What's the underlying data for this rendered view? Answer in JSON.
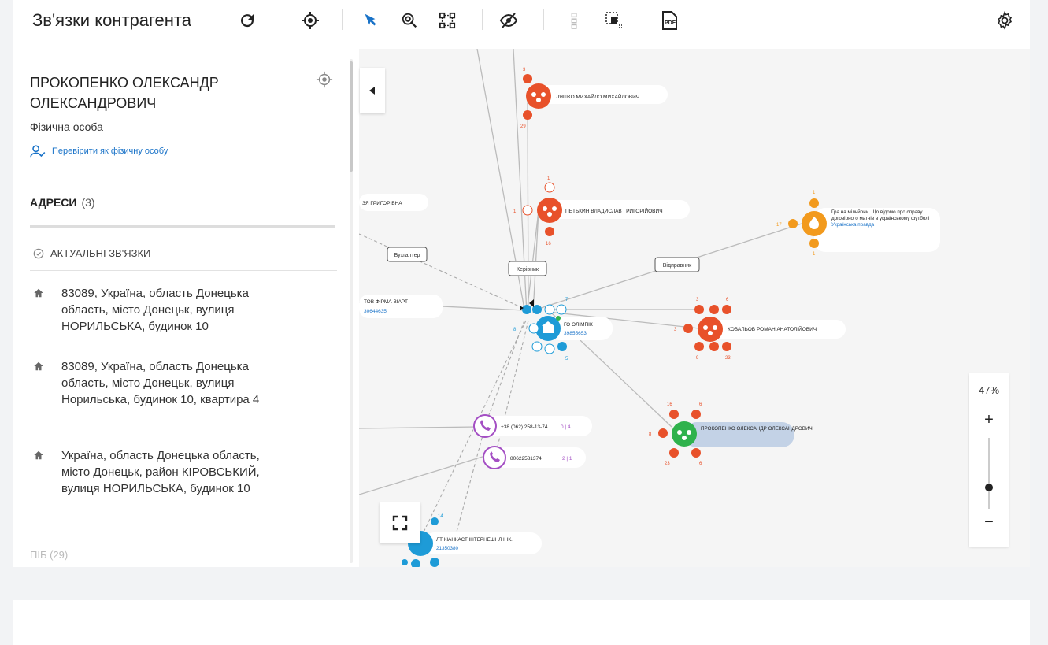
{
  "toolbar": {
    "title": "Зв'язки контрагента",
    "icons": [
      "refresh-icon",
      "target-icon",
      "select-cursor-icon",
      "find-icon",
      "layout-icon",
      "hide-icon",
      "align-icon",
      "group-select-icon",
      "pdf-icon",
      "settings-icon"
    ],
    "accent": "#1a73c8"
  },
  "panel": {
    "person_name": "ПРОКОПЕНКО ОЛЕКСАНДР ОЛЕКСАНДРОВИЧ",
    "person_type": "Фізична особа",
    "check_link": "Перевірити як фізичну особу",
    "addresses_title": "АДРЕСИ",
    "addresses_count": "(3)",
    "actual_links": "АКТУАЛЬНІ ЗВ'ЯЗКИ",
    "addresses": [
      "83089, Україна, область Донецька область, місто Донецьк, вулиця НОРИЛЬСЬКА, будинок 10",
      "83089, Україна, область Донецька область, місто Донецьк, вулиця Норильська, будинок 10, квартира 4",
      "Україна, область Донецька область, місто Донецьк, район КІРОВСЬКИЙ, вулиця НОРИЛЬСЬКА, будинок 10"
    ],
    "pib_label": "ПІБ (29)"
  },
  "graph": {
    "colors": {
      "red": "#e8512a",
      "blue": "#1e9bd7",
      "green": "#2fb24c",
      "orange": "#f29a1d",
      "purple": "#a44fc4",
      "edge": "#bbbbbb"
    },
    "nodes": {
      "n1": {
        "label": "ЛЯШКО МИХАЙЛО МИХАЙЛОВИЧ",
        "top": "3",
        "bottom": "29"
      },
      "n2": {
        "label": "ПЕТЬКИН ВЛАДИСЛАВ ГРИГОРІЙОВИЧ",
        "top": "1",
        "left": "1",
        "bottom": "16"
      },
      "n3": {
        "label": "ГО ОЛІМПІК",
        "sub": "39855653",
        "top": "7",
        "left": "8",
        "right": "7",
        "bottom": "5"
      },
      "n4": {
        "label": "КОВАЛЬОВ РОМАН АНАТОЛІЙОВИЧ",
        "top1": "3",
        "top2": "6",
        "left": "3",
        "bottom1": "9",
        "bottom2": "23"
      },
      "n5": {
        "label": "ПРОКОПЕНКО ОЛЕКСАНДР ОЛЕКСАНДРОВИЧ",
        "top1": "16",
        "top2": "6",
        "left": "8",
        "bottom1": "23",
        "bottom2": "6"
      },
      "n6": {
        "label": "Гра на мільйони. Що відомо про справу договірного матчів в українському футболі",
        "sub": "Українська правда",
        "top": "1",
        "left": "17",
        "bottom": "1"
      },
      "n7": {
        "label": "ТОВ ФІРМА ВІАРТ",
        "sub": "30644635"
      },
      "n8": {
        "label": "+38 (062) 258-13-74",
        "sub": "0 | 4"
      },
      "n9": {
        "label": "80622581374",
        "sub": "2 | 1"
      },
      "n10": {
        "label": "ЛТ КІАНКАСТ ІНТЕРНЕШНЛ ІНК.",
        "sub": "21350380",
        "top": "14"
      },
      "n11": {
        "label": "ЗЯ ГРИГОРІВНА"
      }
    },
    "edge_labels": [
      "Бухгалтер",
      "Керівник",
      "Відправник"
    ]
  },
  "zoom": {
    "percent": "47%",
    "plus": "+",
    "minus": "−",
    "level": 0.47
  }
}
